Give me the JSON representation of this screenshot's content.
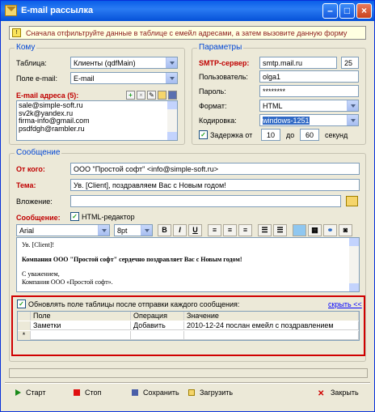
{
  "window": {
    "title": "E-mail рассылка"
  },
  "hint": "Сначала отфильтруйте данные в таблице с емейл адресами, а затем вызовите данную форму",
  "komu": {
    "group_label": "Кому",
    "table_label": "Таблица:",
    "table_value": "Клиенты (qdfMain)",
    "field_label": "Поле e-mail:",
    "field_value": "E-mail",
    "emails_label": "E-mail адреса (5):",
    "emails": [
      "sale@simple-soft.ru",
      "sv2k@yandex.ru",
      "firma-info@gmail.com",
      "psdfdgh@rambler.ru"
    ]
  },
  "params": {
    "group_label": "Параметры",
    "smtp_label": "SMTP-сервер:",
    "smtp_value": "smtp.mail.ru",
    "port": "25",
    "user_label": "Пользователь:",
    "user_value": "olga1",
    "pass_label": "Пароль:",
    "pass_value": "********",
    "format_label": "Формат:",
    "format_value": "HTML",
    "enc_label": "Кодировка:",
    "enc_value": "windows-1251",
    "delay_label": "Задержка  от",
    "delay_from": "10",
    "delay_do": "до",
    "delay_to": "60",
    "delay_unit": "секунд"
  },
  "message": {
    "group_label": "Сообщение",
    "from_label": "От кого:",
    "from_value": "ООО \"Простой софт\" <info@simple-soft.ru>",
    "subject_label": "Тема:",
    "subject_value": "Ув. [Client], поздравляем Вас с Новым годом!",
    "attach_label": "Вложение:",
    "attach_value": "",
    "msg_label": "Сообщение:",
    "html_editor": "HTML-редактор",
    "font": "Arial",
    "size": "8pt",
    "bold": "B",
    "italic": "I",
    "underline": "U",
    "body_line1": "Ув. [Client]!",
    "body_line2": "Компания ООО \"Простой софт\" сердечно поздравляет Вас с Новым годом!",
    "body_line3": "С уважением,",
    "body_line4": "Компания ООО «Простой софт»."
  },
  "update": {
    "checkbox_label": "Обновлять поле таблицы после отправки каждого сообщения:",
    "hide_link": "скрыть <<",
    "columns": [
      "Поле",
      "Операция",
      "Значение"
    ],
    "rows": [
      {
        "field": "Заметки",
        "op": "Добавить",
        "value": "2010-12-24 послан емейл с поздравлением"
      }
    ],
    "new_row_marker": "*"
  },
  "buttons": {
    "start": "Старт",
    "stop": "Стоп",
    "save": "Сохранить",
    "load": "Загрузить",
    "close": "Закрыть"
  }
}
